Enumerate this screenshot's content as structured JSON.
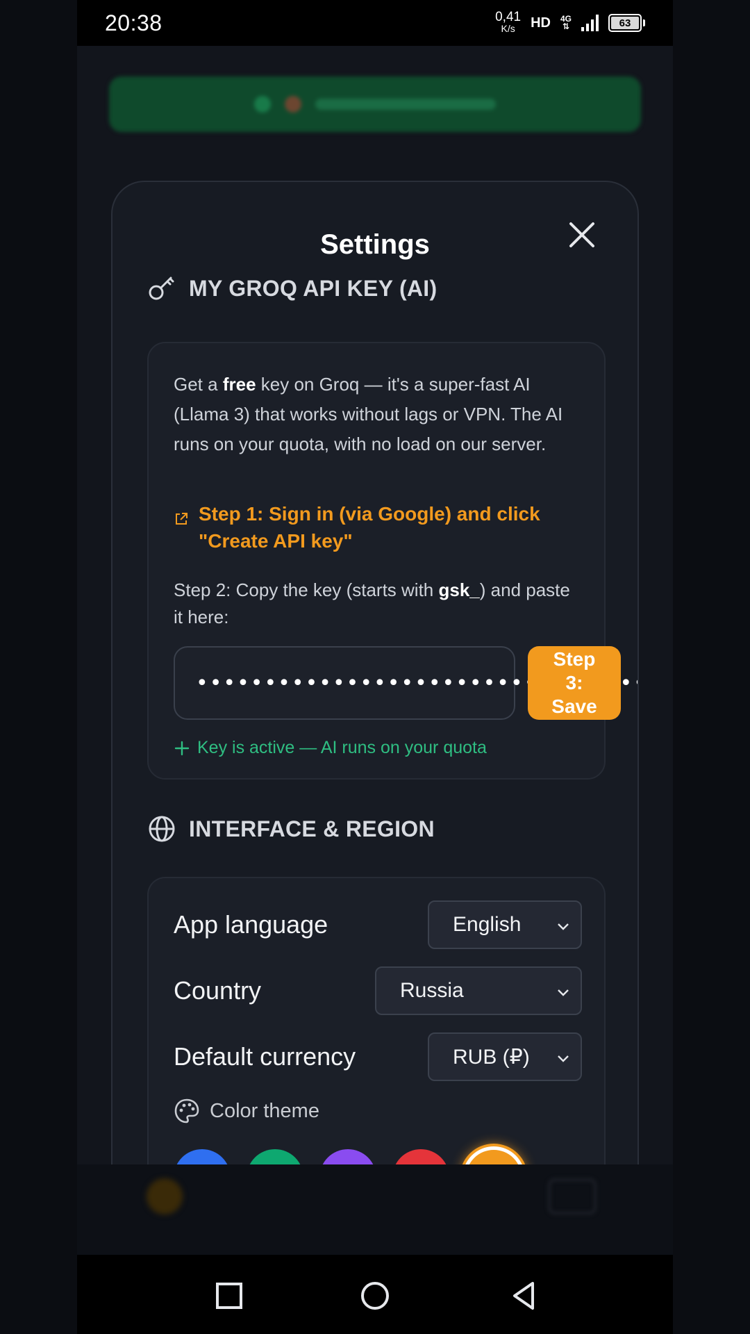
{
  "status": {
    "time": "20:38",
    "net_speed": "0,41",
    "net_unit": "K/s",
    "hd": "HD",
    "net_type": "4G",
    "battery": "63"
  },
  "modal": {
    "title": "Settings",
    "api_section": {
      "heading": "MY GROQ API KEY (AI)",
      "desc_1": "Get a ",
      "desc_bold": "free",
      "desc_2": " key on Groq — it's a super-fast AI (Llama 3) that works without lags or VPN. The AI runs on your quota, with no load on our server.",
      "step1": "Step 1: Sign in (via Google) and click \"Create API key\"",
      "step2_1": "Step 2: Copy the key (starts with ",
      "step2_bold": "gsk_",
      "step2_2": ") and paste it here:",
      "key_value": "••••••••••••••••••••••••••••••••••••••",
      "save_line1": "Step",
      "save_line2": "3:",
      "save_line3": "Save",
      "status": "Key is active — AI runs on your quota"
    },
    "interface_section": {
      "heading": "INTERFACE & REGION",
      "language_label": "App language",
      "language_value": "English",
      "country_label": "Country",
      "country_value": "Russia",
      "currency_label": "Default currency",
      "currency_value": "RUB (₽)",
      "theme_label": "Color theme",
      "themes": [
        {
          "name": "blue",
          "color": "#2f6ff0"
        },
        {
          "name": "green",
          "color": "#0ea870"
        },
        {
          "name": "purple",
          "color": "#8a4cf0"
        },
        {
          "name": "red",
          "color": "#e5343a"
        },
        {
          "name": "orange",
          "color": "#f29a1e",
          "selected": true
        }
      ]
    }
  },
  "colors": {
    "accent": "#f29a1e",
    "success": "#2fbe82",
    "modal_bg": "#171b23"
  }
}
